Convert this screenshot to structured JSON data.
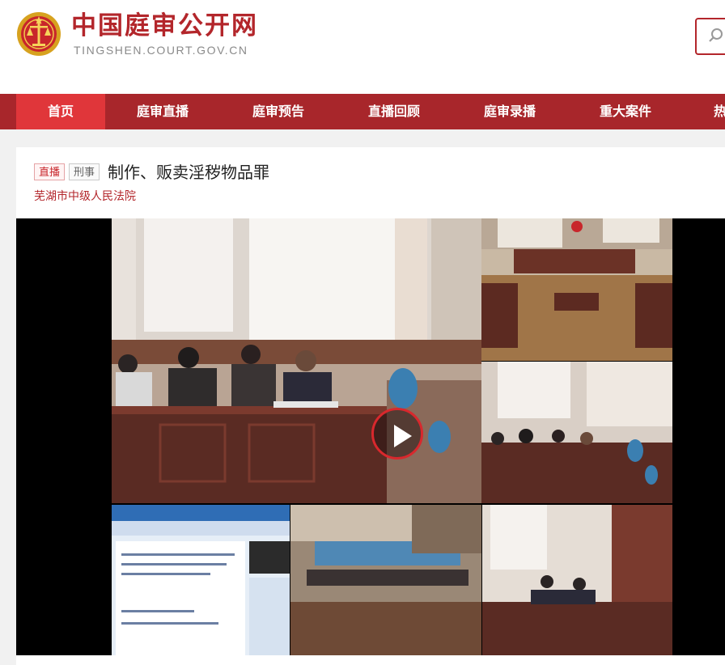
{
  "header": {
    "site_name": "中国庭审公开网",
    "site_url": "TINGSHEN.COURT.GOV.CN",
    "logo_icon": "court-emblem-icon",
    "search_icon": "search-icon"
  },
  "nav": {
    "items": [
      {
        "label": "首页",
        "active": true
      },
      {
        "label": "庭审直播",
        "active": false
      },
      {
        "label": "庭审预告",
        "active": false
      },
      {
        "label": "直播回顾",
        "active": false
      },
      {
        "label": "庭审录播",
        "active": false
      },
      {
        "label": "重大案件",
        "active": false
      },
      {
        "label": "热",
        "active": false
      }
    ]
  },
  "case": {
    "tag_live": "直播",
    "tag_type": "刑事",
    "title": "制作、贩卖淫秽物品罪",
    "court": "芜湖市中级人民法院"
  },
  "video": {
    "play_icon": "play-icon"
  },
  "colors": {
    "brand_red": "#b3262b",
    "nav_bg": "#a8262b",
    "nav_active": "#e0363a"
  }
}
